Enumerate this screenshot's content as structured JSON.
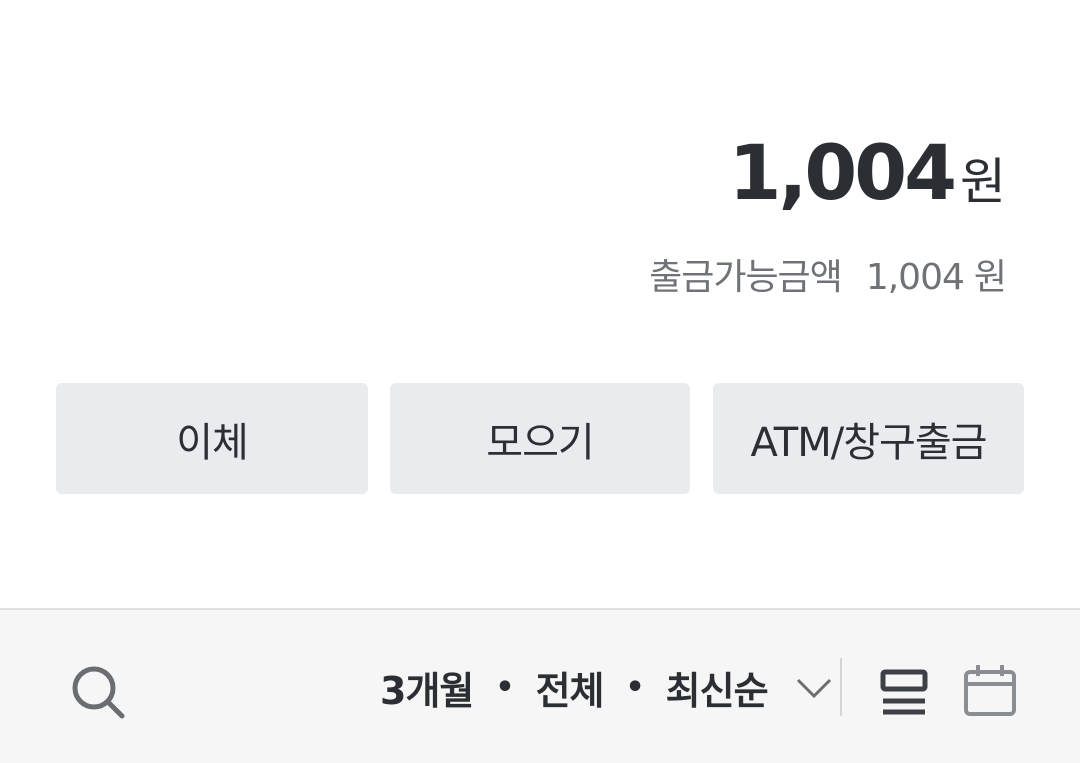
{
  "balance": {
    "amount": "1,004",
    "unit": "원"
  },
  "available": {
    "label": "출금가능금액",
    "amount": "1,004",
    "unit": "원"
  },
  "actions": [
    {
      "label": "이체"
    },
    {
      "label": "모으기"
    },
    {
      "label": "ATM/창구출금"
    }
  ],
  "filter": {
    "period": "3개월",
    "type": "전체",
    "order": "최신순",
    "separator": "•"
  },
  "icons": {
    "search": "search-icon",
    "dropdown": "chevron-down-icon",
    "list_view": "list-view-icon",
    "calendar_view": "calendar-icon"
  },
  "colors": {
    "button_bg": "#e9ecef",
    "filter_bar_bg": "#f6f6f6",
    "text_primary": "#2b2e33",
    "text_secondary": "#6f7378"
  }
}
